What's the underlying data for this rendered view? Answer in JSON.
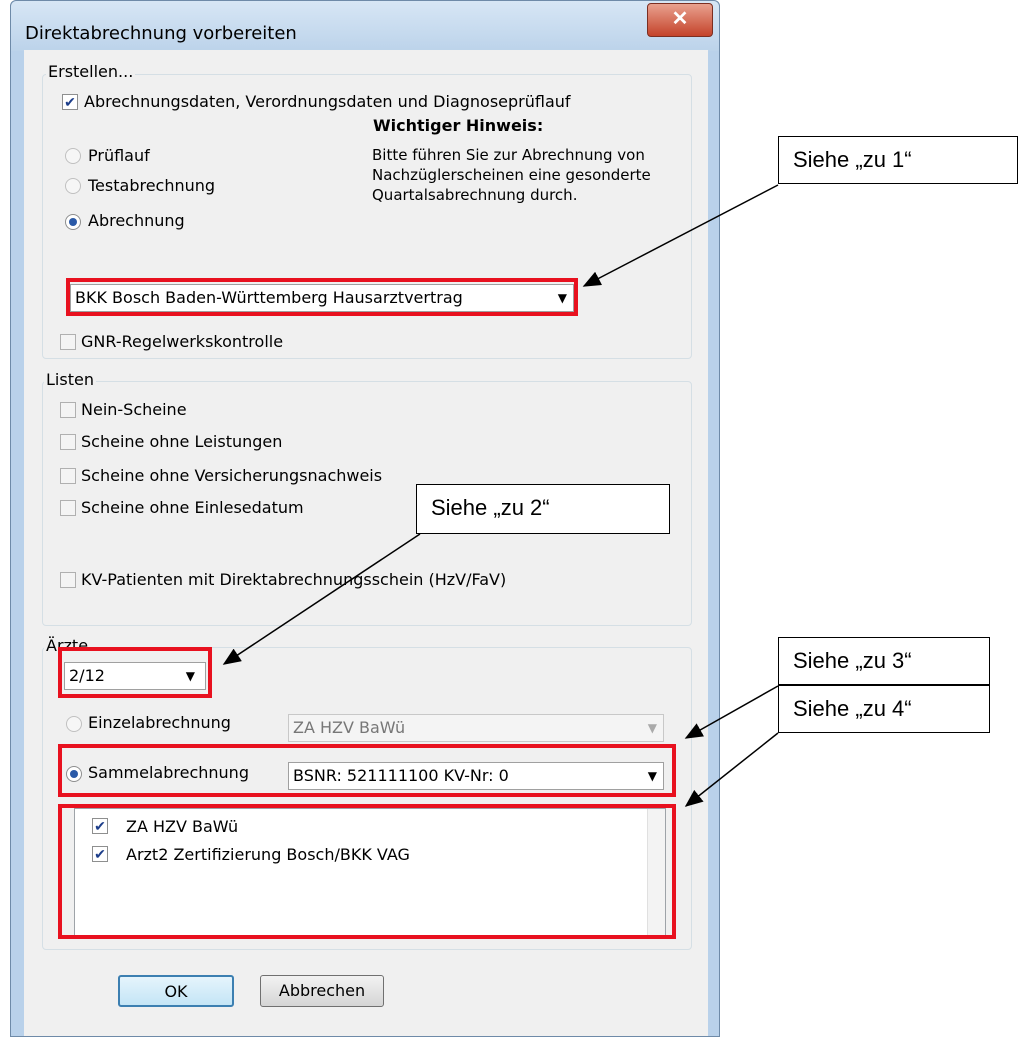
{
  "window": {
    "title": "Direktabrechnung vorbereiten",
    "close_glyph": "✕"
  },
  "erstellen": {
    "group_label": "Erstellen...",
    "main_checkbox_label": "Abrechnungsdaten, Verordnungsdaten und Diagnoseprüflauf",
    "main_checkbox_checked": true,
    "modes": [
      {
        "label": "Prüflauf",
        "selected": false
      },
      {
        "label": "Testabrechnung",
        "selected": false
      },
      {
        "label": "Abrechnung",
        "selected": true
      }
    ],
    "notice_title": "Wichtiger Hinweis:",
    "notice_lines": [
      "Bitte führen Sie zur Abrechnung von",
      "Nachzüglerscheinen eine gesonderte",
      "Quartalsabrechnung durch."
    ],
    "contract_select": "BKK Bosch Baden-Württemberg Hausarztvertrag",
    "gnr_label": "GNR-Regelwerkskontrolle",
    "gnr_checked": false
  },
  "listen": {
    "group_label": "Listen",
    "items": [
      {
        "label": "Nein-Scheine",
        "checked": false
      },
      {
        "label": "Scheine ohne Leistungen",
        "checked": false
      },
      {
        "label": "Scheine ohne Versicherungsnachweis",
        "checked": false
      },
      {
        "label": "Scheine ohne Einlesedatum",
        "checked": false
      }
    ],
    "kv_label": "KV-Patienten mit Direktabrechnungsschein (HzV/FaV)",
    "kv_checked": false
  },
  "aerzte": {
    "group_label": "Ärzte",
    "count_select": "2/12",
    "einzel_label": "Einzelabrechnung",
    "einzel_selected": false,
    "einzel_select": "ZA    HZV BaWü",
    "sammel_label": "Sammelabrechnung",
    "sammel_selected": true,
    "sammel_select": "BSNR: 521111100     KV-Nr: 0",
    "doctors": [
      {
        "label": "ZA    HZV BaWü",
        "checked": true
      },
      {
        "label": "Arzt2  Zertifizierung Bosch/BKK VAG",
        "checked": true
      }
    ]
  },
  "buttons": {
    "ok": "OK",
    "cancel": "Abbrechen"
  },
  "callouts": [
    "Siehe „zu 1“",
    "Siehe „zu 2“",
    "Siehe „zu 3“",
    "Siehe „zu 4“"
  ],
  "colors": {
    "highlight": "#e8111f",
    "titlebar": "#c9dcef",
    "dialog_bg": "#f0f0f0"
  }
}
